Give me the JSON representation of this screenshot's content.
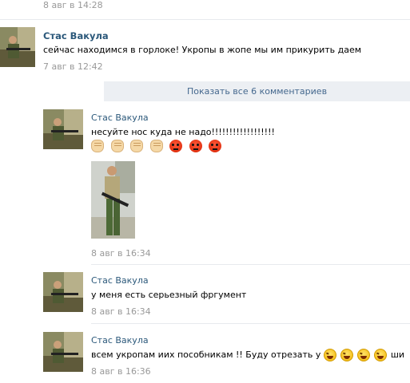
{
  "top_comment": {
    "time": "8 авг в 14:28"
  },
  "post": {
    "author": "Стас Вакула",
    "text": "сейчас находимся в горлоке! Укропы в жопе мы им прикурить даем",
    "time": "7 авг в 12:42"
  },
  "show_all_comments": "Показать все 6 комментариев",
  "comments": [
    {
      "author": "Стас Вакула",
      "text": "несуйте нос куда не надо!!!!!!!!!!!!!!!!!!",
      "emoji": [
        "fist",
        "fist",
        "fist",
        "fist",
        "angry",
        "angry",
        "angry"
      ],
      "has_photo": true,
      "time": "8 авг в 16:34"
    },
    {
      "author": "Стас Вакула",
      "text": "у меня есть серьезный фргумент",
      "time": "8 авг в 16:34"
    },
    {
      "author": "Стас Вакула",
      "text_before": "всем укропам иих пособникам !! Буду отрезать у",
      "emoji": [
        "laugh",
        "laugh",
        "laugh",
        "laugh"
      ],
      "text_after": "ши",
      "time": "8 авг в 16:36"
    }
  ],
  "colors": {
    "link": "#2b587a",
    "time": "#999999",
    "show_all_bg": "#eceff3",
    "show_all_text": "#45688e"
  }
}
